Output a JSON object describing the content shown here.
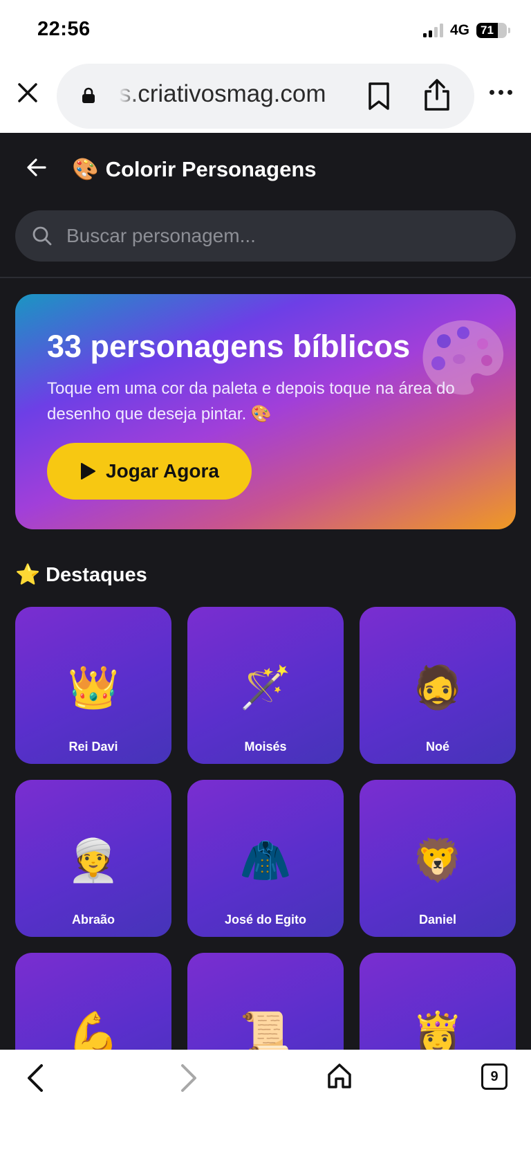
{
  "status_bar": {
    "time": "22:56",
    "network": "4G",
    "battery": "71",
    "battery_level": 0.71
  },
  "browser": {
    "url": "s.criativosmag.com",
    "close_icon": "close-icon",
    "lock_icon": "lock-icon",
    "bookmark_icon": "bookmark-icon",
    "share_icon": "share-icon",
    "more_icon": "more-icon"
  },
  "header": {
    "title_emoji": "🎨",
    "title": "Colorir Personagens",
    "back_icon": "arrow-left-icon"
  },
  "search": {
    "placeholder": "Buscar personagem..."
  },
  "hero": {
    "title": "33 personagens bíblicos",
    "text": "Toque em uma cor da paleta e depois toque na área do desenho que deseja pintar. 🎨",
    "button_label": "Jogar Agora",
    "accent_color": "#f7c812"
  },
  "section": {
    "emoji": "⭐",
    "title": "Destaques"
  },
  "characters": [
    {
      "emoji": "👑",
      "name": "Rei Davi"
    },
    {
      "emoji": "🪄",
      "name": "Moisés"
    },
    {
      "emoji": "🧔",
      "name": "Noé"
    },
    {
      "emoji": "👳",
      "name": "Abraão"
    },
    {
      "emoji": "🧥",
      "name": "José do Egito"
    },
    {
      "emoji": "🦁",
      "name": "Daniel"
    },
    {
      "emoji": "💪",
      "name": ""
    },
    {
      "emoji": "📜",
      "name": ""
    },
    {
      "emoji": "👸",
      "name": ""
    }
  ],
  "toolbar": {
    "back_icon": "chevron-left-icon",
    "forward_icon": "chevron-right-icon",
    "home_icon": "home-icon",
    "tabs_count": "9"
  }
}
